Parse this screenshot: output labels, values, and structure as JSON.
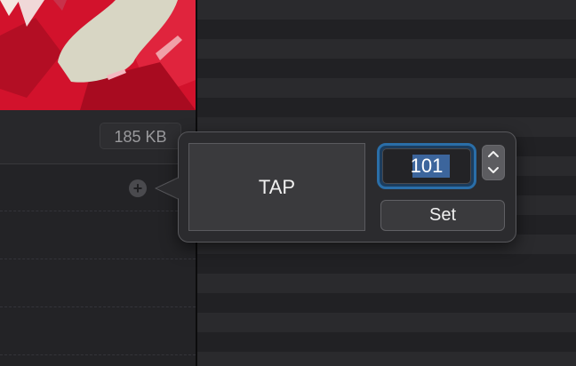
{
  "file_info": {
    "size": "185 KB"
  },
  "icons": {
    "add": "plus-circle-icon",
    "stepper_up": "chevron-up-icon",
    "stepper_down": "chevron-down-icon"
  },
  "bpm_popover": {
    "tap_label": "TAP",
    "bpm_value": "101",
    "set_label": "Set"
  },
  "colors": {
    "focus_ring": "#2a6ea8",
    "selection": "#3c659c",
    "artwork_red": "#d2122c"
  }
}
